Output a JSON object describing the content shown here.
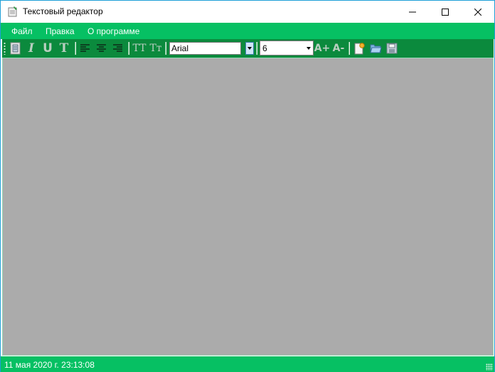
{
  "window": {
    "title": "Текстовый редактор",
    "icons": {
      "app": "notepad-icon",
      "minimize": "minimize-icon",
      "maximize": "maximize-icon",
      "close": "close-icon"
    }
  },
  "menu": {
    "items": [
      "Файл",
      "Правка",
      "О программе"
    ]
  },
  "toolbar": {
    "buttons": [
      {
        "name": "format-painter-icon"
      },
      {
        "name": "italic-icon",
        "glyph": "I"
      },
      {
        "name": "underline-icon",
        "glyph": "U"
      },
      {
        "name": "strikethrough-icon",
        "glyph": "T"
      },
      {
        "name": "align-left-icon"
      },
      {
        "name": "align-center-icon"
      },
      {
        "name": "align-right-icon"
      },
      {
        "name": "uppercase-icon",
        "glyph": "TT"
      },
      {
        "name": "titlecase-icon",
        "glyph": "Tт"
      },
      {
        "name": "increase-font-icon",
        "glyph": "A+"
      },
      {
        "name": "decrease-font-icon",
        "glyph": "A-"
      },
      {
        "name": "new-document-icon"
      },
      {
        "name": "open-folder-icon"
      },
      {
        "name": "save-icon"
      }
    ],
    "font_name": "Arial",
    "font_size": "6"
  },
  "status": {
    "datetime": "11 мая 2020 г. 23:13:08"
  },
  "colors": {
    "menubar": "#06c063",
    "toolbar": "#0b8a3d",
    "editor_bg": "#ababab",
    "statusbar": "#06c063"
  }
}
